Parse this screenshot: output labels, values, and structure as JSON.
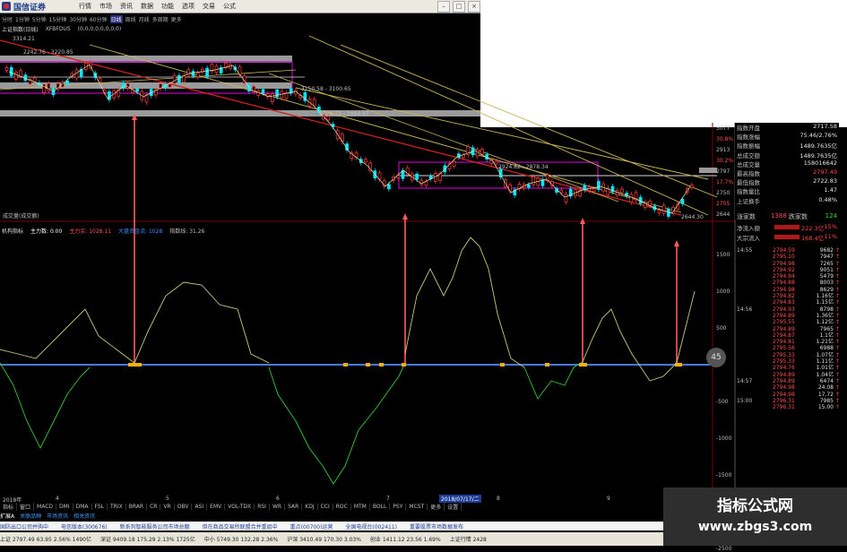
{
  "app": {
    "logo": "国信证券",
    "menu": [
      "行情",
      "市场",
      "资讯",
      "数据",
      "功能",
      "选项",
      "交易",
      "公式"
    ],
    "window_buttons": [
      "–",
      "□",
      "×"
    ]
  },
  "toolbar": {
    "periods": [
      "分时",
      "1分钟",
      "5分钟",
      "15分钟",
      "30分钟",
      "60分钟",
      "日线",
      "周线",
      "月线",
      "多周期",
      "更多"
    ],
    "selected_period": "日线"
  },
  "chart_header": {
    "title": "上证指数(日线)",
    "indicator": "XFBFDUS",
    "params": "(0,0,0,0,0,0,0,0)"
  },
  "price_labels": {
    "high_label": "3314.21",
    "box1_label": "2242.76 - 3220.85",
    "box2_label": "3150.58 - 3100.65",
    "mid_label": "3024.73 - 2984.97",
    "box3_label": "2924.82 - 2878.34",
    "low_label": "2644.30",
    "volume_label": "成交量(成交额)"
  },
  "right_scale_upper": [
    "3077",
    "30.8%",
    "2913",
    "30.2%",
    "2797",
    "17.7%",
    "2750",
    "2705",
    "2644"
  ],
  "indicator_header": {
    "name": "机构指标",
    "main_label": "主力数: 0.00",
    "mid_label": "主力买: 1028.11",
    "big_label": "大盘资金流: 1028",
    "tail_label": "指数线: 31.26"
  },
  "right_scale_lower": [
    "1500",
    "1000",
    "500",
    "0",
    "-500",
    "-1000",
    "-1500",
    "-2000",
    "-2500"
  ],
  "info_panel": {
    "rows": [
      {
        "label": "指数开盘",
        "value": "2717.58",
        "red": false
      },
      {
        "label": "指数涨幅",
        "value": "75.46/2.76%",
        "red": false
      },
      {
        "label": "指数振幅",
        "value": "1489.7635亿",
        "red": false
      },
      {
        "label": "总成交额",
        "value": "1489.7635亿",
        "red": false
      },
      {
        "label": "总成交量",
        "value": "158016642",
        "red": false
      },
      {
        "label": "最高指数",
        "value": "2797.49",
        "red": true
      },
      {
        "label": "最低指数",
        "value": "2722.83",
        "red": false
      },
      {
        "label": "指数量比",
        "value": "1.47",
        "red": false
      },
      {
        "label": "上证换手",
        "value": "0.48%",
        "red": false
      }
    ],
    "updown": {
      "up_label": "涨家数",
      "up": "1388",
      "down_label": "跌家数",
      "down": "124"
    },
    "flow": [
      {
        "label": "净流入额",
        "value": "222.3亿",
        "pct": "15%"
      },
      {
        "label": "大宗流入",
        "value": "168.4亿",
        "pct": "11%"
      }
    ]
  },
  "ticks": [
    {
      "time": "14:55",
      "price": "2794.59",
      "vol": "9682",
      "side": "↑"
    },
    {
      "time": "",
      "price": "2795.10",
      "vol": "7947",
      "side": "↑"
    },
    {
      "time": "",
      "price": "2794.98",
      "vol": "7265",
      "side": "↑"
    },
    {
      "time": "",
      "price": "2794.92",
      "vol": "9051",
      "side": "↑"
    },
    {
      "time": "",
      "price": "2794.94",
      "vol": "5479",
      "side": "↑"
    },
    {
      "time": "",
      "price": "2794.88",
      "vol": "8003",
      "side": "↑"
    },
    {
      "time": "",
      "price": "2794.98",
      "vol": "8629",
      "side": "↑"
    },
    {
      "time": "",
      "price": "2794.82",
      "vol": "1.16亿",
      "side": "↑"
    },
    {
      "time": "",
      "price": "2794.83",
      "vol": "1.15亿",
      "side": "↑"
    },
    {
      "time": "14:56",
      "price": "2794.93",
      "vol": "8798",
      "side": "↑"
    },
    {
      "time": "",
      "price": "2794.89",
      "vol": "1.36亿",
      "side": "↑"
    },
    {
      "time": "",
      "price": "2795.55",
      "vol": "1.12亿",
      "side": "↑"
    },
    {
      "time": "",
      "price": "2794.89",
      "vol": "7965",
      "side": "↑"
    },
    {
      "time": "",
      "price": "2794.87",
      "vol": "1.1亿",
      "side": "↑"
    },
    {
      "time": "",
      "price": "2794.81",
      "vol": "1.21亿",
      "side": "↑"
    },
    {
      "time": "",
      "price": "2795.56",
      "vol": "6988",
      "side": "↑"
    },
    {
      "time": "",
      "price": "2795.33",
      "vol": "1.07亿",
      "side": "↑"
    },
    {
      "time": "",
      "price": "2795.33",
      "vol": "1.11亿",
      "side": "↑"
    },
    {
      "time": "",
      "price": "2794.76",
      "vol": "1.01亿",
      "side": "↑"
    },
    {
      "time": "",
      "price": "2794.89",
      "vol": "1.04亿",
      "side": "↑"
    },
    {
      "time": "14:57",
      "price": "2794.89",
      "vol": "6474",
      "side": "↑"
    },
    {
      "time": "",
      "price": "2794.98",
      "vol": "24.08",
      "side": "↑"
    },
    {
      "time": "",
      "price": "2794.98",
      "vol": "17.72",
      "side": "↑"
    },
    {
      "time": "15:00",
      "price": "2796.31",
      "vol": "7985",
      "side": "↑"
    },
    {
      "time": "",
      "price": "2796.31",
      "vol": "15.00",
      "side": "↑"
    }
  ],
  "bottom_axis": {
    "left_label": "2018年",
    "date_label": "2018/07/17/二",
    "months": [
      "4",
      "5",
      "6",
      "7",
      "8",
      "9"
    ]
  },
  "indicator_tabs": [
    "指标",
    "窗口",
    "MACD",
    "DMI",
    "DMA",
    "FSL",
    "TRIX",
    "BRAR",
    "CR",
    "VR",
    "OBV",
    "ASI",
    "EMV",
    "VOL-TDX",
    "RSI",
    "WR",
    "SAR",
    "KDJ",
    "CCI",
    "ROC",
    "MTM",
    "BOLL",
    "PSY",
    "MCST",
    "更多",
    "设置"
  ],
  "sub_tabs": [
    "扩展A",
    "关联品种",
    "市场资讯",
    "相关资讯"
  ],
  "news": [
    "国防出口公司并购中",
    "电信版本(300676)",
    "新系列智能服务公司市场总额",
    "但在商品交易所联盟合并重组中",
    "重点(00700)运营",
    "全国电视台(002411)",
    "重要股票市场数据发布"
  ],
  "status": [
    "上证 2797.49  63.95  2.56%  1490亿",
    "深证 9409.18  175.29  2.13%  1725亿",
    "中小 5749.30  132.28  2.36%",
    "沪深 3410.49  170.30  3.03%",
    "创业 1411.12  23.56  1.69%",
    "上证行情 2428"
  ],
  "watermark": {
    "line1": "指标公式网",
    "line2": "www.zbgs3.com"
  },
  "zoom_badge": "45",
  "colors": {
    "bg": "#000000",
    "up": "#ff3c3c",
    "down": "#00e5ff",
    "box": "#c000c0",
    "trend_red": "#d02020",
    "trend_yellow": "#c8b45a",
    "osc": "#c8c87a",
    "osc_neg": "#32c832",
    "signal": "#ffb000"
  }
}
